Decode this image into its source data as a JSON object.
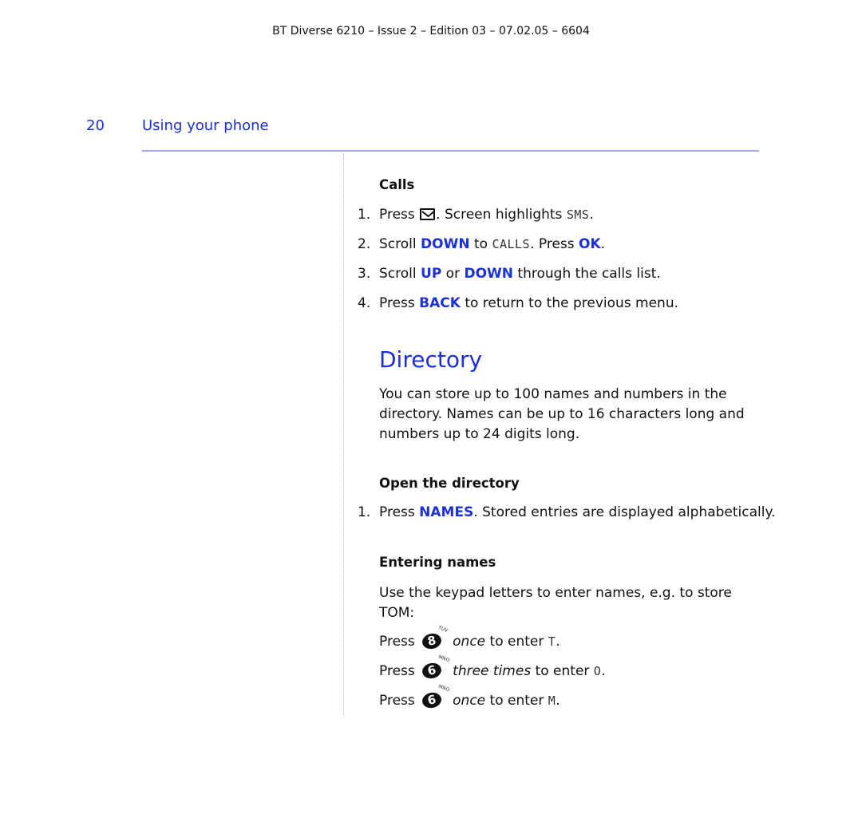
{
  "header": {
    "doc_id": "BT Diverse 6210 – Issue 2 – Edition 03 – 07.02.05 – 6604"
  },
  "page": {
    "number": "20",
    "section": "Using your phone"
  },
  "calls": {
    "heading": "Calls",
    "steps": [
      {
        "n": "1.",
        "t1": "Press ",
        "icon": "envelope-key-icon",
        "t2": ". Screen highlights ",
        "lcd": "SMS",
        "t3": "."
      },
      {
        "n": "2.",
        "t1": "Scroll ",
        "kw1": "DOWN",
        "t2": " to ",
        "lcd": "CALLS",
        "t3": ". Press ",
        "kw2": "OK",
        "t4": "."
      },
      {
        "n": "3.",
        "t1": "Scroll ",
        "kw1": "UP",
        "t2": " or ",
        "kw2": "DOWN",
        "t3": " through the calls list."
      },
      {
        "n": "4.",
        "t1": "Press ",
        "kw1": "BACK",
        "t2": " to return to the previous menu."
      }
    ]
  },
  "directory": {
    "heading": "Directory",
    "intro_lines": [
      "You can store up to 100 names and numbers in the",
      "directory. Names can be up to 16 characters long and",
      "numbers up to 24 digits long."
    ],
    "open": {
      "heading": "Open the directory",
      "step": {
        "n": "1.",
        "t1": "Press ",
        "kw1": "NAMES",
        "t2": ". Stored entries are displayed alphabetically."
      }
    },
    "entering": {
      "heading": "Entering names",
      "intro_lines": [
        "Use the keypad letters to enter names, e.g. to store",
        "TOM:"
      ],
      "presses": [
        {
          "press": "Press",
          "key": "8",
          "letters": "TUV",
          "times": "once",
          "rest": " to enter ",
          "char": "T",
          "end": "."
        },
        {
          "press": "Press",
          "key": "6",
          "letters": "MNO",
          "times": "three times",
          "rest": " to enter ",
          "char": "O",
          "end": "."
        },
        {
          "press": "Press",
          "key": "6",
          "letters": "MNO",
          "times": "once",
          "rest": " to enter ",
          "char": "M",
          "end": "."
        }
      ]
    }
  },
  "colors": {
    "accent_blue": "#1b2fd4",
    "rule": "#a3a8f3"
  }
}
